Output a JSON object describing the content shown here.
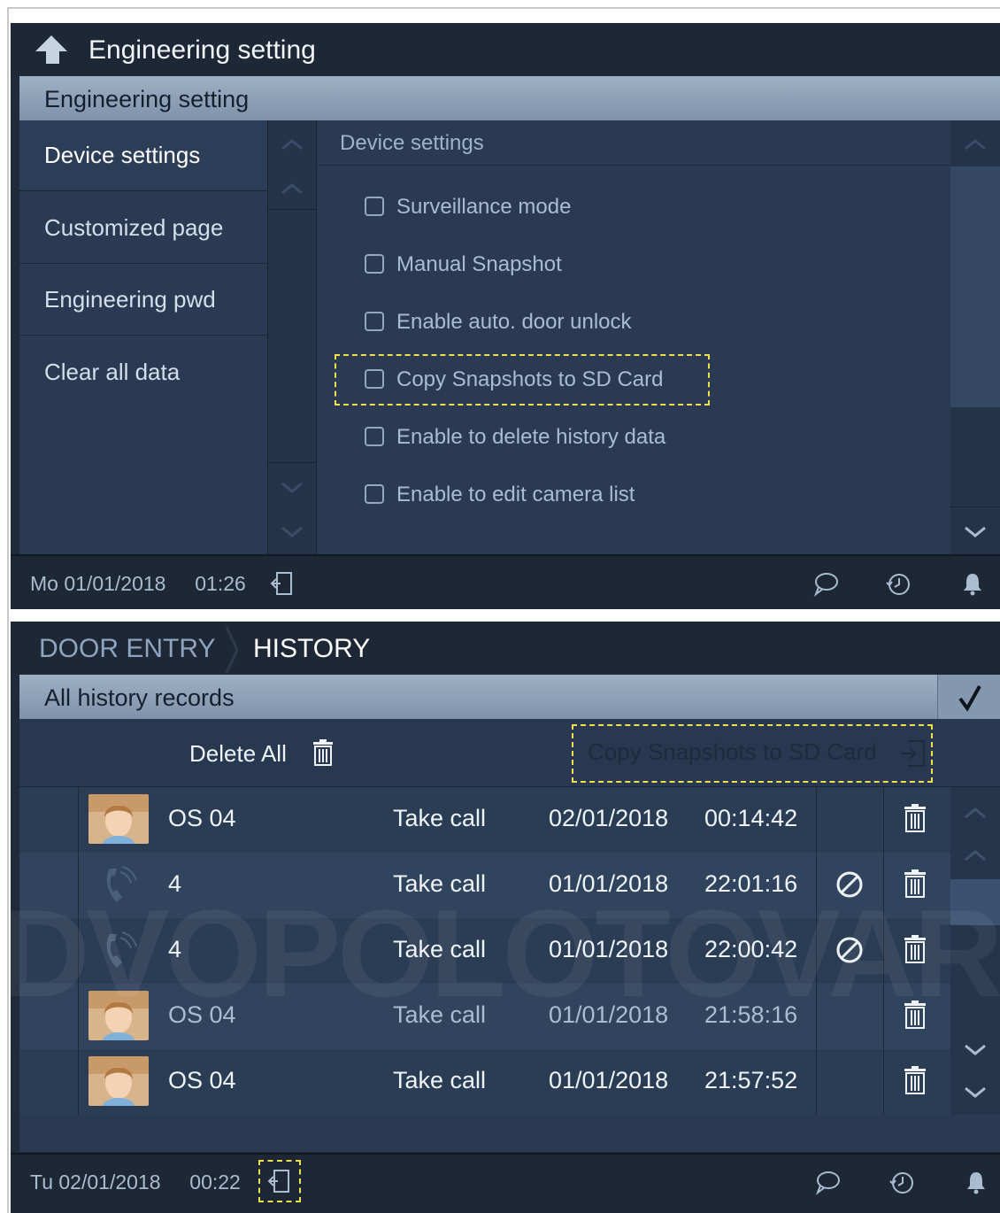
{
  "top_screen": {
    "title": "Engineering setting",
    "band_label": "Engineering setting",
    "nav": [
      {
        "label": "Device settings"
      },
      {
        "label": "Customized page"
      },
      {
        "label": "Engineering pwd"
      },
      {
        "label": "Clear all data"
      }
    ],
    "content_title": "Device settings",
    "options": [
      {
        "label": "Surveillance mode",
        "checked": false
      },
      {
        "label": "Manual Snapshot",
        "checked": false
      },
      {
        "label": "Enable auto. door unlock",
        "checked": false
      },
      {
        "label": "Copy Snapshots to SD Card",
        "checked": false
      },
      {
        "label": "Enable to delete history data",
        "checked": false
      },
      {
        "label": "Enable to edit camera list",
        "checked": false
      }
    ],
    "status": {
      "day": "Mo",
      "date": "01/01/2018",
      "time": "01:26"
    }
  },
  "bottom_screen": {
    "breadcrumb_parent": "DOOR ENTRY",
    "breadcrumb_current": "HISTORY",
    "band_label": "All history records",
    "delete_all_label": "Delete All",
    "copy_label": "Copy Snapshots to SD Card",
    "records": [
      {
        "kind": "snapshot",
        "name": "OS 04",
        "action": "Take call",
        "date": "02/01/2018",
        "time": "00:14:42",
        "blocked": false
      },
      {
        "kind": "call",
        "name": "4",
        "action": "Take call",
        "date": "01/01/2018",
        "time": "22:01:16",
        "blocked": true
      },
      {
        "kind": "call",
        "name": "4",
        "action": "Take call",
        "date": "01/01/2018",
        "time": "22:00:42",
        "blocked": true
      },
      {
        "kind": "snapshot",
        "name": "OS 04",
        "action": "Take call",
        "date": "01/01/2018",
        "time": "21:58:16",
        "blocked": false
      },
      {
        "kind": "snapshot",
        "name": "OS 04",
        "action": "Take call",
        "date": "01/01/2018",
        "time": "21:57:52",
        "blocked": false
      }
    ],
    "status": {
      "day": "Tu",
      "date": "02/01/2018",
      "time": "00:22"
    }
  },
  "watermark": "DVOPOLOTOVAR",
  "colors": {
    "accent_dash": "#f0e14a",
    "panel": "#2a3a52",
    "band": "#8fa2b9"
  }
}
